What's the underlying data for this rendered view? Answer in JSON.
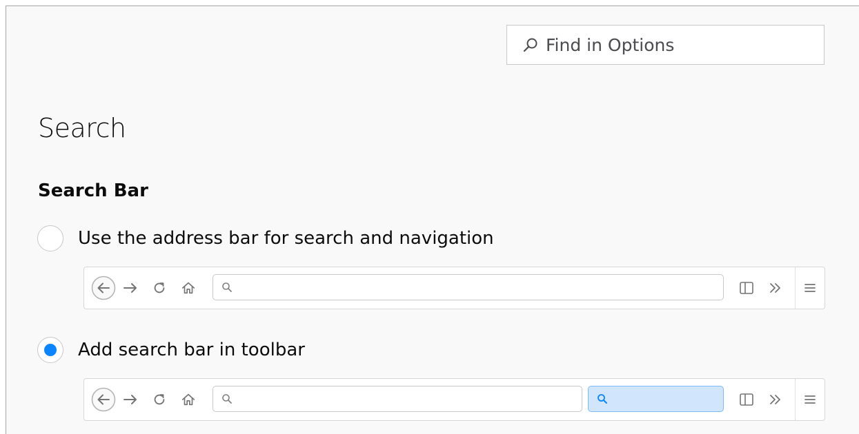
{
  "search_box": {
    "placeholder": "Find in Options",
    "icon": "search-icon"
  },
  "page": {
    "title": "Search"
  },
  "search_bar": {
    "heading": "Search Bar",
    "options": [
      {
        "label": "Use the address bar for search and navigation",
        "selected": false,
        "preview": "address-bar-only-toolbar"
      },
      {
        "label": "Add search bar in toolbar",
        "selected": true,
        "preview": "address-and-search-bar-toolbar"
      }
    ]
  },
  "toolbar_icons": [
    "back-icon",
    "forward-icon",
    "reload-icon",
    "home-icon",
    "search-icon",
    "sidebar-icon",
    "overflow-icon",
    "menu-icon"
  ],
  "colors": {
    "accent": "#0a84ff",
    "panel_background": "#f9f9fa",
    "search_highlight": "#d1e6fd"
  }
}
